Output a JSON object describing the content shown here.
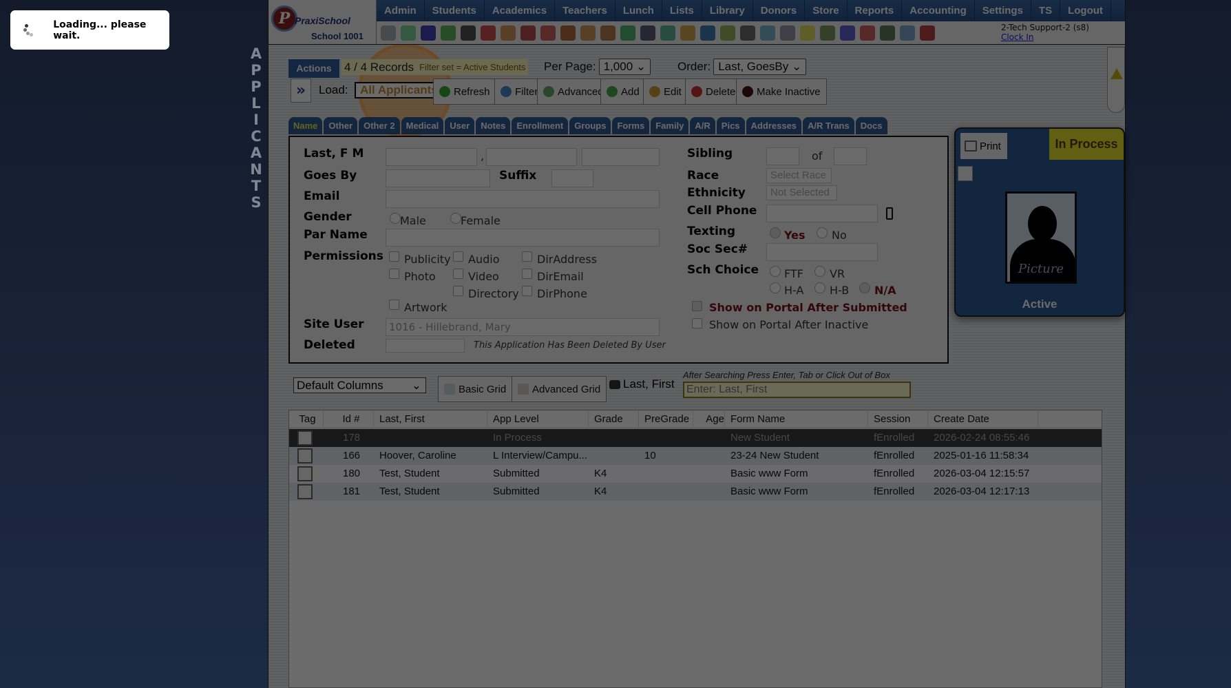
{
  "side_title": [
    "A",
    "P",
    "P",
    "L",
    "I",
    "C",
    "A",
    "N",
    "T",
    "S"
  ],
  "logo": {
    "brand": "PraxiSchool",
    "school": "School 1001"
  },
  "nav": [
    "Admin",
    "Students",
    "Academics",
    "Teachers",
    "Lunch",
    "Lists",
    "Library",
    "Donors",
    "Store",
    "Reports",
    "Accounting",
    "Settings",
    "TS",
    "Logout"
  ],
  "user": {
    "name": "2-Tech Support-2 (s8)",
    "clock_in": "Clock In"
  },
  "toolbar": {
    "actions": "Actions",
    "records": "4 / 4 Records",
    "filter_set": "Filter set = Active Students",
    "per_page_label": "Per Page:",
    "per_page": "1,000",
    "order_label": "Order:",
    "order": "Last, GoesBy",
    "load_label": "Load:",
    "load_value": "All Applicants",
    "buttons": [
      "Refresh",
      "Filter",
      "Advanced",
      "Add",
      "Edit",
      "Delete",
      "Make Inactive"
    ]
  },
  "tabs": [
    "Name",
    "Other",
    "Other 2",
    "Medical",
    "User",
    "Notes",
    "Enrollment",
    "Groups",
    "Forms",
    "Family",
    "A/R",
    "Pics",
    "Addresses",
    "A/R Trans",
    "Docs"
  ],
  "form": {
    "last_fm": "Last, F M",
    "goes_by": "Goes By",
    "suffix": "Suffix",
    "email": "Email",
    "gender": "Gender",
    "male": "Male",
    "female": "Female",
    "par_name": "Par Name",
    "permissions": "Permissions",
    "perms": [
      "Publicity",
      "Audio",
      "DirAddress",
      "Photo",
      "Video",
      "DirEmail",
      "Directory",
      "DirPhone",
      "Artwork"
    ],
    "site_user": "Site User",
    "site_user_value": "1016 - Hillebrand, Mary",
    "deleted": "Deleted",
    "deleted_note": "This Application Has Been Deleted By User",
    "sibling": "Sibling",
    "of": "of",
    "race": "Race",
    "race_value": "Select Race",
    "ethnicity": "Ethnicity",
    "ethnicity_value": "Not Selected",
    "cell_phone": "Cell Phone",
    "texting": "Texting",
    "yes": "Yes",
    "no": "No",
    "soc_sec": "Soc Sec#",
    "sch_choice": "Sch Choice",
    "ftf": "FTF",
    "vr": "VR",
    "ha": "H-A",
    "hb": "H-B",
    "na": "N/A",
    "portal_submitted": "Show on Portal After Submitted",
    "portal_inactive": "Show on Portal After Inactive"
  },
  "card": {
    "print": "Print",
    "status": "In Process",
    "picture": "Picture",
    "active": "Active"
  },
  "grid": {
    "columns_select": "Default Columns",
    "basic": "Basic Grid",
    "advanced": "Advanced Grid",
    "search_label": "Last, First",
    "hint": "After Searching Press Enter, Tab or Click Out of Box",
    "placeholder": "Enter: Last, First",
    "headers": [
      "Tag",
      "Id #",
      "Last, First",
      "App Level",
      "Grade",
      "PreGrade",
      "Age",
      "Form Name",
      "Session",
      "Create Date"
    ],
    "rows": [
      [
        "",
        "178",
        "",
        "In Process",
        "",
        "",
        "",
        "New Student",
        "fEnrolled",
        "2026-02-24 08:55:46"
      ],
      [
        "",
        "166",
        "Hoover, Caroline",
        "L Interview/Campu...",
        "",
        "10",
        "",
        "23-24 New Student",
        "fEnrolled",
        "2025-01-16 11:58:34"
      ],
      [
        "",
        "180",
        "Test, Student",
        "Submitted",
        "K4",
        "",
        "",
        "Basic www Form",
        "fEnrolled",
        "2026-03-04 12:15:57"
      ],
      [
        "",
        "181",
        "Test, Student",
        "Submitted",
        "K4",
        "",
        "",
        "Basic www Form",
        "fEnrolled",
        "2026-03-04 12:17:13"
      ]
    ]
  },
  "loading": "Loading... please wait."
}
